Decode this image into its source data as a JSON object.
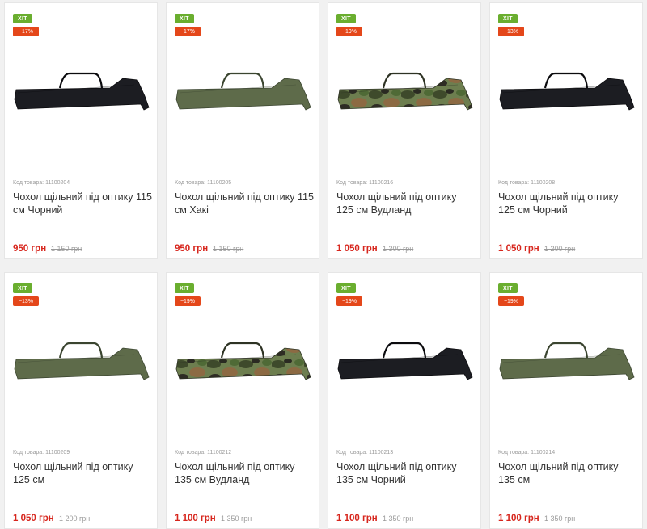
{
  "products": [
    {
      "badge": "ХІТ",
      "discount": "−17%",
      "code": "Код товара: 11100204",
      "title": "Чохол щільний під оптику 115 см Чорний",
      "price": "950 грн",
      "old_price": "1 150 грн",
      "color": "black"
    },
    {
      "badge": "ХІТ",
      "discount": "−17%",
      "code": "Код товара: 11100205",
      "title": "Чохол щільний під оптику 115 см Хакі",
      "price": "950 грн",
      "old_price": "1 150 грн",
      "color": "khaki"
    },
    {
      "badge": "ХІТ",
      "discount": "−19%",
      "code": "Код товара: 11100216",
      "title": "Чохол щільний під оптику 125 см Вудланд",
      "price": "1 050 грн",
      "old_price": "1 300 грн",
      "color": "woodland"
    },
    {
      "badge": "ХІТ",
      "discount": "−13%",
      "code": "Код товара: 11100208",
      "title": "Чохол щільний під оптику 125 см Чорний",
      "price": "1 050 грн",
      "old_price": "1 200 грн",
      "color": "black"
    },
    {
      "badge": "ХІТ",
      "discount": "−13%",
      "code": "Код товара: 11100209",
      "title": "Чохол щільний під оптику 125 см",
      "price": "1 050 грн",
      "old_price": "1 200 грн",
      "color": "khaki"
    },
    {
      "badge": "ХІТ",
      "discount": "−19%",
      "code": "Код товара: 11100212",
      "title": "Чохол щільний під оптику 135 см Вудланд",
      "price": "1 100 грн",
      "old_price": "1 350 грн",
      "color": "woodland"
    },
    {
      "badge": "ХІТ",
      "discount": "−19%",
      "code": "Код товара: 11100213",
      "title": "Чохол щільний під оптику 135 см Чорний",
      "price": "1 100 грн",
      "old_price": "1 350 грн",
      "color": "black"
    },
    {
      "badge": "ХІТ",
      "discount": "−19%",
      "code": "Код товара: 11100214",
      "title": "Чохол щільний під оптику 135 см",
      "price": "1 100 грн",
      "old_price": "1 350 грн",
      "color": "khaki"
    }
  ],
  "colors": {
    "hit": "#6aae2f",
    "discount": "#e4471a",
    "price": "#d7261d",
    "black": "#1c1d22",
    "khaki": "#5e6b4a",
    "woodland_base": "#5f7046"
  }
}
